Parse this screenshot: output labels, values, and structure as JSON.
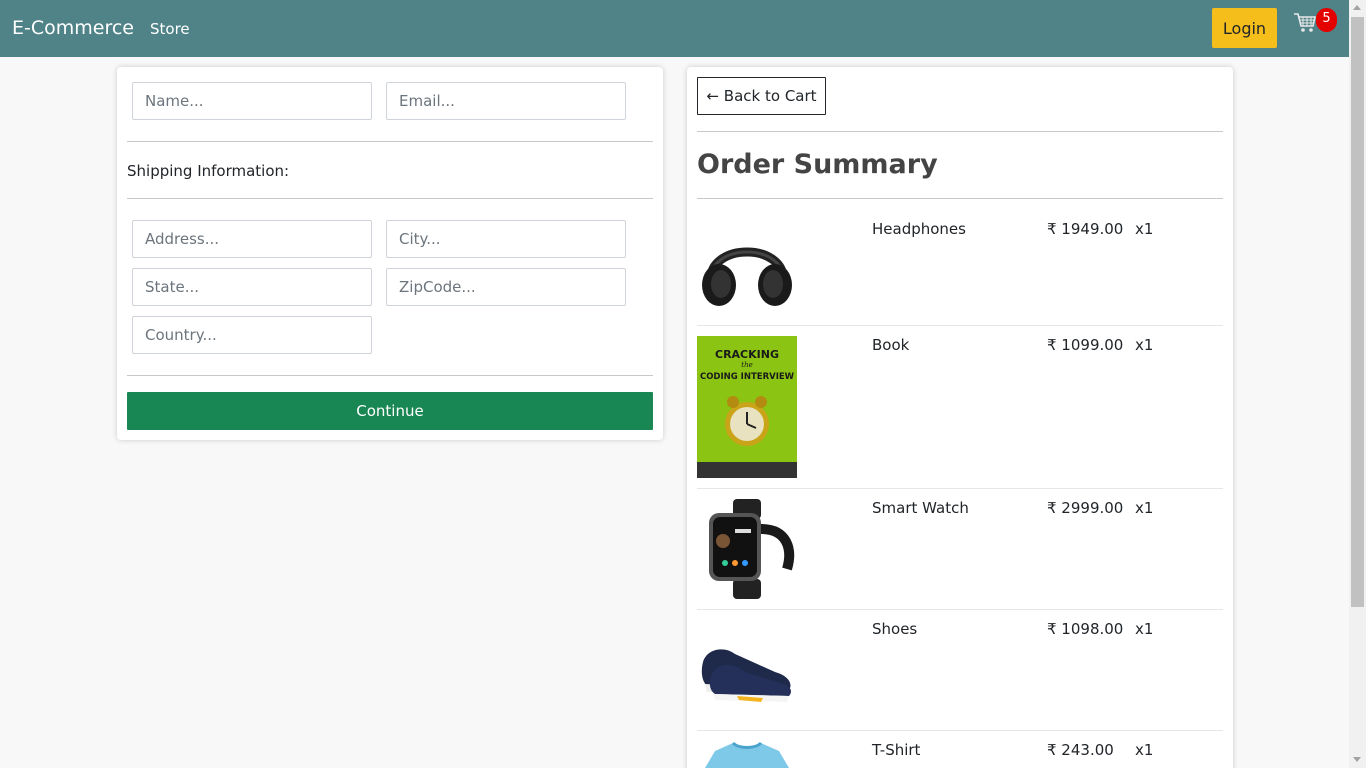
{
  "nav": {
    "brand": "E-Commerce",
    "store_link": "Store",
    "login_label": "Login",
    "cart_count": "5"
  },
  "form": {
    "name_placeholder": "Name...",
    "email_placeholder": "Email...",
    "shipping_heading": "Shipping Information:",
    "address_placeholder": "Address...",
    "city_placeholder": "City...",
    "state_placeholder": "State...",
    "zip_placeholder": "ZipCode...",
    "country_placeholder": "Country...",
    "continue_label": "Continue"
  },
  "summary": {
    "back_label": "← Back to Cart",
    "title": "Order Summary",
    "items": [
      {
        "name": "Headphones",
        "price": "₹ 1949.00",
        "qty": "x1",
        "image": "headphones"
      },
      {
        "name": "Book",
        "price": "₹ 1099.00",
        "qty": "x1",
        "image": "book-cover",
        "image_text": [
          "CRACKING",
          "the",
          "CODING INTERVIEW"
        ]
      },
      {
        "name": "Smart Watch",
        "price": "₹ 2999.00",
        "qty": "x1",
        "image": "smart-watch"
      },
      {
        "name": "Shoes",
        "price": "₹ 1098.00",
        "qty": "x1",
        "image": "shoes"
      },
      {
        "name": "T-Shirt",
        "price": "₹ 243.00",
        "qty": "x1",
        "image": "t-shirt"
      }
    ]
  },
  "colors": {
    "navbar": "#4f8388",
    "login": "#f5be1b",
    "continue": "#198754",
    "badge": "#e50000"
  }
}
